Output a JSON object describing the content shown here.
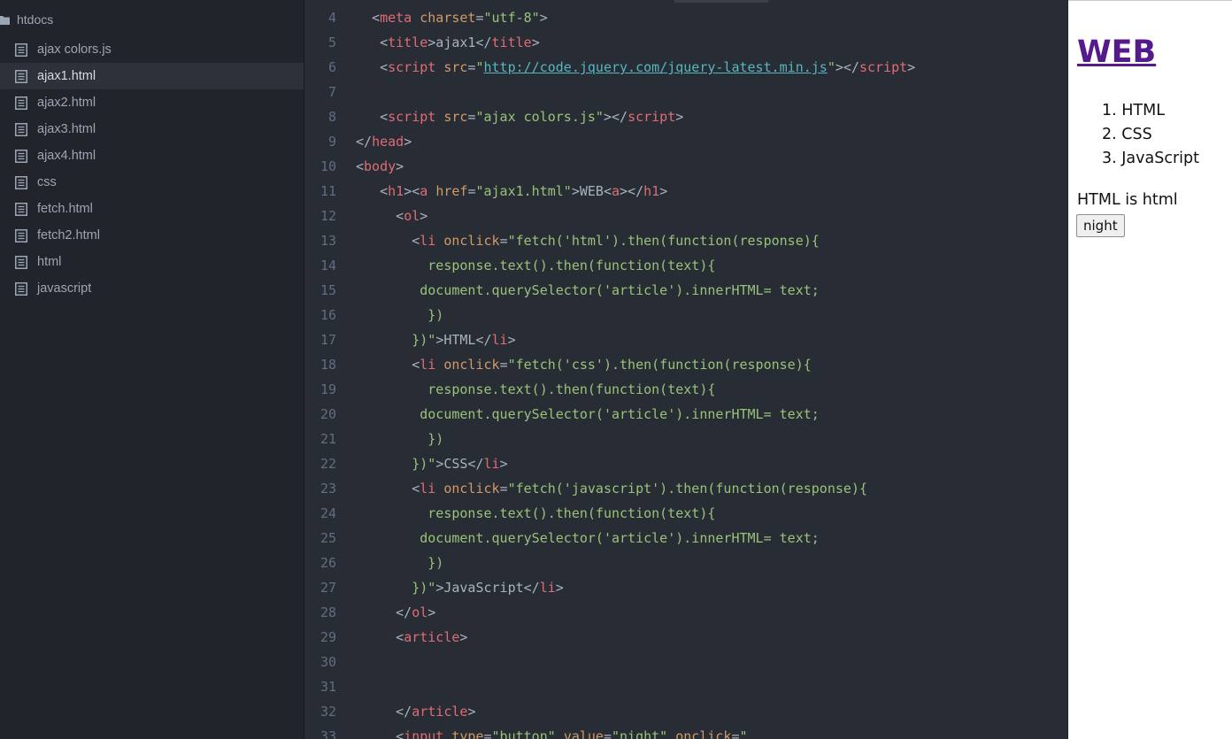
{
  "sidebar": {
    "root_label": "htdocs",
    "items": [
      {
        "label": "ajax colors.js"
      },
      {
        "label": "ajax1.html"
      },
      {
        "label": "ajax2.html"
      },
      {
        "label": "ajax3.html"
      },
      {
        "label": "ajax4.html"
      },
      {
        "label": "css"
      },
      {
        "label": "fetch.html"
      },
      {
        "label": "fetch2.html"
      },
      {
        "label": "html"
      },
      {
        "label": "javascript"
      }
    ],
    "selected_item": "ajax1.html"
  },
  "editor": {
    "lines": [
      {
        "n": "4",
        "tokens": [
          {
            "c": "p",
            "t": "  <"
          },
          {
            "c": "t",
            "t": "meta"
          },
          {
            "c": "p",
            "t": " "
          },
          {
            "c": "a",
            "t": "charset"
          },
          {
            "c": "p",
            "t": "="
          },
          {
            "c": "s",
            "t": "\"utf-8\""
          },
          {
            "c": "p",
            "t": ">"
          }
        ]
      },
      {
        "n": "5",
        "tokens": [
          {
            "c": "p",
            "t": "   <"
          },
          {
            "c": "t",
            "t": "title"
          },
          {
            "c": "p",
            "t": ">ajax1</"
          },
          {
            "c": "t",
            "t": "title"
          },
          {
            "c": "p",
            "t": ">"
          }
        ]
      },
      {
        "n": "6",
        "tokens": [
          {
            "c": "p",
            "t": "   <"
          },
          {
            "c": "t",
            "t": "script"
          },
          {
            "c": "p",
            "t": " "
          },
          {
            "c": "a",
            "t": "src"
          },
          {
            "c": "p",
            "t": "="
          },
          {
            "c": "s",
            "t": "\""
          },
          {
            "c": "u",
            "t": "http://code.jquery.com/jquery-latest.min.js"
          },
          {
            "c": "s",
            "t": "\""
          },
          {
            "c": "p",
            "t": "></"
          },
          {
            "c": "t",
            "t": "script"
          },
          {
            "c": "p",
            "t": ">"
          }
        ]
      },
      {
        "n": "7",
        "tokens": []
      },
      {
        "n": "8",
        "tokens": [
          {
            "c": "p",
            "t": "   <"
          },
          {
            "c": "t",
            "t": "script"
          },
          {
            "c": "p",
            "t": " "
          },
          {
            "c": "a",
            "t": "src"
          },
          {
            "c": "p",
            "t": "="
          },
          {
            "c": "s",
            "t": "\"ajax colors.js\""
          },
          {
            "c": "p",
            "t": "></"
          },
          {
            "c": "t",
            "t": "script"
          },
          {
            "c": "p",
            "t": ">"
          }
        ]
      },
      {
        "n": "9",
        "tokens": [
          {
            "c": "p",
            "t": "</"
          },
          {
            "c": "t",
            "t": "head"
          },
          {
            "c": "p",
            "t": ">"
          }
        ]
      },
      {
        "n": "10",
        "tokens": [
          {
            "c": "p",
            "t": "<"
          },
          {
            "c": "t",
            "t": "body"
          },
          {
            "c": "p",
            "t": ">"
          }
        ]
      },
      {
        "n": "11",
        "tokens": [
          {
            "c": "p",
            "t": "   <"
          },
          {
            "c": "t",
            "t": "h1"
          },
          {
            "c": "p",
            "t": "><"
          },
          {
            "c": "t",
            "t": "a"
          },
          {
            "c": "p",
            "t": " "
          },
          {
            "c": "a",
            "t": "href"
          },
          {
            "c": "p",
            "t": "="
          },
          {
            "c": "s",
            "t": "\"ajax1.html\""
          },
          {
            "c": "p",
            "t": ">WEB<"
          },
          {
            "c": "t",
            "t": "a"
          },
          {
            "c": "p",
            "t": "></"
          },
          {
            "c": "t",
            "t": "h1"
          },
          {
            "c": "p",
            "t": ">"
          }
        ]
      },
      {
        "n": "12",
        "tokens": [
          {
            "c": "p",
            "t": "     <"
          },
          {
            "c": "t",
            "t": "ol"
          },
          {
            "c": "p",
            "t": ">"
          }
        ]
      },
      {
        "n": "13",
        "tokens": [
          {
            "c": "p",
            "t": "       <"
          },
          {
            "c": "t",
            "t": "li"
          },
          {
            "c": "p",
            "t": " "
          },
          {
            "c": "a",
            "t": "onclick"
          },
          {
            "c": "p",
            "t": "="
          },
          {
            "c": "s",
            "t": "\"fetch('html').then(function(response){"
          }
        ]
      },
      {
        "n": "14",
        "tokens": [
          {
            "c": "s",
            "t": "         response.text().then(function(text){"
          }
        ]
      },
      {
        "n": "15",
        "tokens": [
          {
            "c": "s",
            "t": "        document.querySelector('article').innerHTML= text;"
          }
        ]
      },
      {
        "n": "16",
        "tokens": [
          {
            "c": "s",
            "t": "         })"
          }
        ]
      },
      {
        "n": "17",
        "tokens": [
          {
            "c": "s",
            "t": "       })\""
          },
          {
            "c": "p",
            "t": ">HTML</"
          },
          {
            "c": "t",
            "t": "li"
          },
          {
            "c": "p",
            "t": ">"
          }
        ]
      },
      {
        "n": "18",
        "tokens": [
          {
            "c": "p",
            "t": "       <"
          },
          {
            "c": "t",
            "t": "li"
          },
          {
            "c": "p",
            "t": " "
          },
          {
            "c": "a",
            "t": "onclick"
          },
          {
            "c": "p",
            "t": "="
          },
          {
            "c": "s",
            "t": "\"fetch('css').then(function(response){"
          }
        ]
      },
      {
        "n": "19",
        "tokens": [
          {
            "c": "s",
            "t": "         response.text().then(function(text){"
          }
        ]
      },
      {
        "n": "20",
        "tokens": [
          {
            "c": "s",
            "t": "        document.querySelector('article').innerHTML= text;"
          }
        ]
      },
      {
        "n": "21",
        "tokens": [
          {
            "c": "s",
            "t": "         })"
          }
        ]
      },
      {
        "n": "22",
        "tokens": [
          {
            "c": "s",
            "t": "       })\""
          },
          {
            "c": "p",
            "t": ">CSS</"
          },
          {
            "c": "t",
            "t": "li"
          },
          {
            "c": "p",
            "t": ">"
          }
        ]
      },
      {
        "n": "23",
        "tokens": [
          {
            "c": "p",
            "t": "       <"
          },
          {
            "c": "t",
            "t": "li"
          },
          {
            "c": "p",
            "t": " "
          },
          {
            "c": "a",
            "t": "onclick"
          },
          {
            "c": "p",
            "t": "="
          },
          {
            "c": "s",
            "t": "\"fetch('javascript').then(function(response){"
          }
        ]
      },
      {
        "n": "24",
        "tokens": [
          {
            "c": "s",
            "t": "         response.text().then(function(text){"
          }
        ]
      },
      {
        "n": "25",
        "tokens": [
          {
            "c": "s",
            "t": "        document.querySelector('article').innerHTML= text;"
          }
        ]
      },
      {
        "n": "26",
        "tokens": [
          {
            "c": "s",
            "t": "         })"
          }
        ]
      },
      {
        "n": "27",
        "tokens": [
          {
            "c": "s",
            "t": "       })\""
          },
          {
            "c": "p",
            "t": ">JavaScript</"
          },
          {
            "c": "t",
            "t": "li"
          },
          {
            "c": "p",
            "t": ">"
          }
        ]
      },
      {
        "n": "28",
        "tokens": [
          {
            "c": "p",
            "t": "     </"
          },
          {
            "c": "t",
            "t": "ol"
          },
          {
            "c": "p",
            "t": ">"
          }
        ]
      },
      {
        "n": "29",
        "tokens": [
          {
            "c": "p",
            "t": "     <"
          },
          {
            "c": "t",
            "t": "article"
          },
          {
            "c": "p",
            "t": ">"
          }
        ]
      },
      {
        "n": "30",
        "tokens": []
      },
      {
        "n": "31",
        "tokens": []
      },
      {
        "n": "32",
        "tokens": [
          {
            "c": "p",
            "t": "     </"
          },
          {
            "c": "t",
            "t": "article"
          },
          {
            "c": "p",
            "t": ">"
          }
        ]
      },
      {
        "n": "33",
        "tokens": [
          {
            "c": "p",
            "t": "     <"
          },
          {
            "c": "t",
            "t": "input"
          },
          {
            "c": "p",
            "t": " "
          },
          {
            "c": "a",
            "t": "type"
          },
          {
            "c": "p",
            "t": "="
          },
          {
            "c": "s",
            "t": "\"button\""
          },
          {
            "c": "p",
            "t": " "
          },
          {
            "c": "a",
            "t": "value"
          },
          {
            "c": "p",
            "t": "="
          },
          {
            "c": "s",
            "t": "\"night\""
          },
          {
            "c": "p",
            "t": " "
          },
          {
            "c": "a",
            "t": "onclick"
          },
          {
            "c": "p",
            "t": "="
          },
          {
            "c": "s",
            "t": "\""
          }
        ]
      }
    ]
  },
  "preview": {
    "heading_link": "WEB",
    "list": [
      "1. HTML",
      "2. CSS",
      "3. JavaScript"
    ],
    "article_text": "HTML is html",
    "button_label": "night"
  },
  "colors": {
    "sidebar_bg": "#21252b",
    "editor_bg": "#282c34",
    "selected_bg": "#2c313a",
    "tag": "#e06c75",
    "attribute": "#d19a66",
    "string": "#98c379",
    "url": "#56b6c2",
    "link_visited": "#551a8b"
  }
}
